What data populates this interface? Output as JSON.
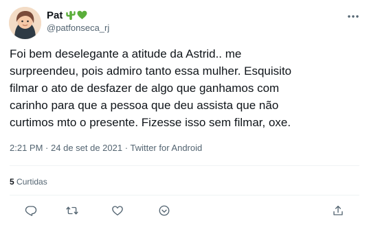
{
  "user": {
    "display_name": "Pat",
    "handle": "@patfonseca_rj",
    "emoji_icons": [
      "cactus-icon",
      "green-heart-icon"
    ]
  },
  "tweet": {
    "lines": [
      "Foi bem deselegante a atitude da Astrid.. me",
      "surpreendeu, pois admiro tanto essa mulher. Esquisito",
      "filmar o ato de desfazer de algo que ganhamos com",
      "carinho para que a pessoa que deu assista que não",
      "curtimos mto o presente. Fizesse isso sem filmar, oxe."
    ],
    "time": "2:21 PM",
    "separator": "·",
    "date": "24 de set de 2021",
    "source": "Twitter for Android"
  },
  "stats": {
    "retweets_count": "5",
    "retweets_label": "Curtidas"
  },
  "actions": [
    "reply-icon",
    "retweet-icon",
    "like-icon",
    "bookmark-icon",
    "share-icon"
  ],
  "colors": {
    "text": "#0f1419",
    "secondary": "#536471",
    "divider": "#eff3f4",
    "emoji_green": "#5aae3a"
  }
}
